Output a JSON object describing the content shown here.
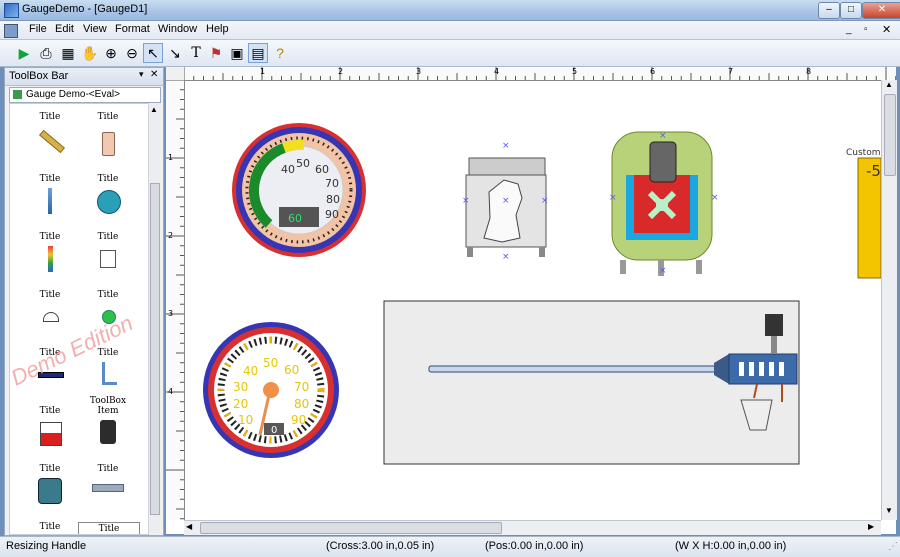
{
  "window": {
    "title": "GaugeDemo - [GaugeD1]"
  },
  "menu": [
    "File",
    "Edit",
    "View",
    "Format",
    "Window",
    "Help"
  ],
  "toolbox": {
    "header": "ToolBox Bar",
    "tab_label": "Gauge Demo-<Eval>",
    "items": [
      "Title",
      "Title",
      "Title",
      "Title",
      "Title",
      "Title",
      "Title",
      "Title",
      "Title",
      "Title",
      "Title",
      "ToolBox Item",
      "Title",
      "Title",
      "Title",
      "Title"
    ],
    "watermark": "Demo Edition"
  },
  "rulers": {
    "h_labels": [
      "1",
      "2",
      "3",
      "4",
      "5",
      "6",
      "7",
      "8"
    ],
    "v_labels": [
      "1",
      "2",
      "3",
      "4"
    ]
  },
  "canvas": {
    "gauge1": {
      "ticks": [
        "40",
        "50",
        "60",
        "70",
        "80",
        "90"
      ],
      "digital": "60"
    },
    "gauge2": {
      "ticks": [
        "10",
        "20",
        "30",
        "40",
        "50",
        "60",
        "70",
        "80",
        "90"
      ],
      "digital": "0"
    },
    "custom_label": "Custom",
    "custom_value": "-5"
  },
  "status": {
    "message": "Resizing Handle",
    "cross": "(Cross:3.00 in,0.05 in)",
    "pos": "(Pos:0.00 in,0.00 in)",
    "size": "(W X H:0.00 in,0.00 in)"
  },
  "colors": {
    "accent": "#3a6ea5",
    "gauge_ring": "#3a3ab8",
    "gauge_red": "#d03030"
  }
}
